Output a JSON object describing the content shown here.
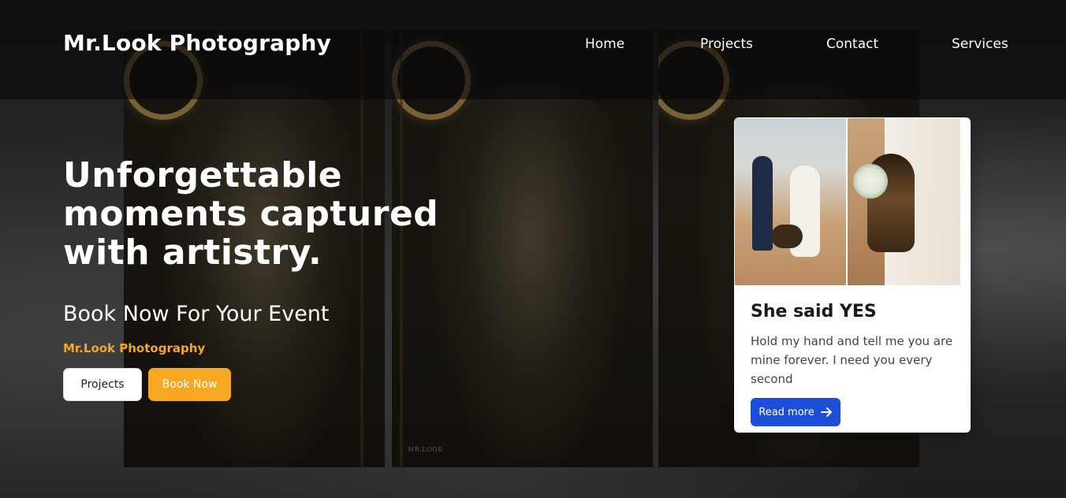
{
  "header": {
    "brand": "Mr.Look Photography",
    "nav": [
      {
        "label": "Home"
      },
      {
        "label": "Projects"
      },
      {
        "label": "Contact"
      },
      {
        "label": "Services"
      }
    ]
  },
  "hero": {
    "headline": "Unforgettable moments captured with artistry.",
    "subheadline": "Book Now For Your Event",
    "tagline": "Mr.Look Photography",
    "buttons": {
      "projects": "Projects",
      "book": "Book Now"
    },
    "watermark": "MR.LOOK"
  },
  "card": {
    "title": "She said YES",
    "text": "Hold my hand and tell me you are mine forever. I need you every second",
    "button": "Read more",
    "button_icon": "arrow-right-icon"
  },
  "colors": {
    "accent": "#f7a823",
    "tagline": "#f5a623",
    "card_button": "#1d4ed8",
    "header_overlay": "#080808"
  }
}
